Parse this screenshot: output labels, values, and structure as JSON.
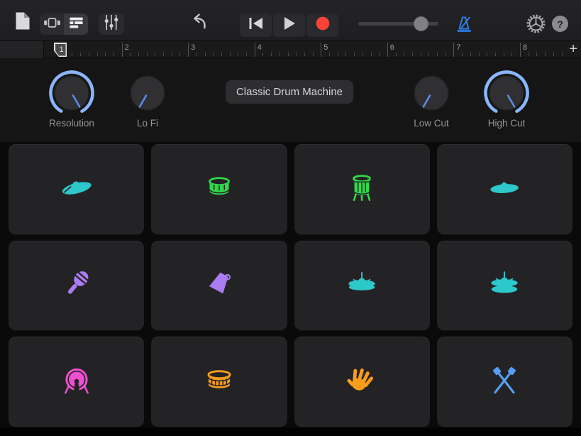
{
  "colors": {
    "accent_blue": "#2e7ce8",
    "record_red": "#fb4338",
    "knob_arc": "#8ab5f8",
    "knob_pointer": "#5d8fe9",
    "pad_teal": "#2dc8ca",
    "pad_green": "#31d94b",
    "pad_purple": "#aa7df2",
    "pad_pink": "#ef4fd0",
    "pad_orange": "#f79c1b",
    "pad_blue": "#55a0f2"
  },
  "toolbar": {
    "icons": [
      "document-icon",
      "live-loops-grid-icon",
      "tracks-view-icon",
      "track-controls-icon",
      "undo-icon",
      "rewind-icon",
      "play-icon",
      "record-icon",
      "metronome-icon",
      "settings-icon"
    ],
    "volume_slider": {
      "value_pct": 78
    },
    "help_label": "?"
  },
  "ruler": {
    "measures": [
      "1",
      "2",
      "3",
      "4",
      "5",
      "6",
      "7",
      "8"
    ],
    "playhead_measure": "1",
    "add_button": "+"
  },
  "controls": {
    "patch_button": "Classic Drum Machine",
    "knobs": [
      {
        "label": "Resolution",
        "position": "max"
      },
      {
        "label": "Lo Fi",
        "position": "min"
      },
      {
        "label": "Low Cut",
        "position": "min"
      },
      {
        "label": "High Cut",
        "position": "max"
      }
    ]
  },
  "pads": [
    {
      "name": "ride-cymbal",
      "icon": "ride-cymbal-icon",
      "color": "#2dc8ca"
    },
    {
      "name": "snare-drum",
      "icon": "snare-front-icon",
      "color": "#31d94b"
    },
    {
      "name": "floor-tom",
      "icon": "floor-tom-icon",
      "color": "#31d94b"
    },
    {
      "name": "crash-cymbal",
      "icon": "crash-cymbal-icon",
      "color": "#2dc8ca"
    },
    {
      "name": "shaker",
      "icon": "maraca-icon",
      "color": "#aa7df2"
    },
    {
      "name": "cowbell",
      "icon": "cowbell-icon",
      "color": "#aa7df2"
    },
    {
      "name": "hi-hat-closed",
      "icon": "closed-hihat-icon",
      "color": "#2dc8ca"
    },
    {
      "name": "hi-hat-open",
      "icon": "open-hihat-icon",
      "color": "#2dc8ca"
    },
    {
      "name": "kick-drum",
      "icon": "kick-drum-icon",
      "color": "#ef4fd0"
    },
    {
      "name": "snare-side",
      "icon": "snare-side-icon",
      "color": "#f79c1b"
    },
    {
      "name": "hand-clap",
      "icon": "clap-icon",
      "color": "#f79c1b"
    },
    {
      "name": "drumsticks",
      "icon": "crossed-sticks-icon",
      "color": "#55a0f2"
    }
  ]
}
